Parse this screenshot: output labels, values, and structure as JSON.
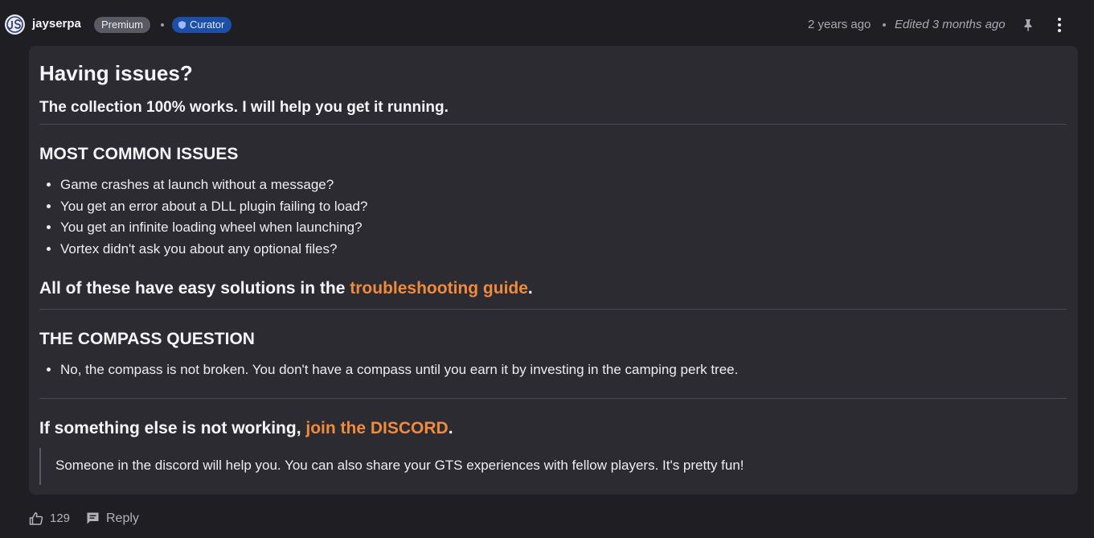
{
  "header": {
    "username": "jayserpa",
    "badge_premium": "Premium",
    "badge_curator": "Curator",
    "posted": "2 years ago",
    "edited": "Edited 3 months ago",
    "icons": {
      "avatar": "avatar-icon",
      "curator": "shield-icon",
      "pin": "pin-icon",
      "more": "more-vertical-icon"
    }
  },
  "post": {
    "title": "Having issues?",
    "subtitle": "The collection 100% works. I will help you get it running.",
    "section1_title": "MOST COMMON ISSUES",
    "section1_items": [
      "Game crashes at launch without a message?",
      "You get an error about a DLL plugin failing to load?",
      "You get an infinite loading wheel when launching?",
      "Vortex didn't ask you about any optional files?"
    ],
    "solutions_prefix": "All of these have easy solutions in the ",
    "solutions_link": "troubleshooting guide",
    "solutions_suffix": ".",
    "section2_title": "THE COMPASS QUESTION",
    "section2_items": [
      "No, the compass is not broken. You don't have a compass until you earn it by investing in the camping perk tree."
    ],
    "discord_prefix": "If something else is not working, ",
    "discord_link": "join the DISCORD",
    "discord_suffix": ".",
    "quote": "Someone in the discord will help you. You can also share your GTS experiences with fellow players. It's pretty fun!"
  },
  "footer": {
    "like_count": "129",
    "reply_label": "Reply"
  },
  "colors": {
    "background": "#1f1f23",
    "card": "#2b2b31",
    "link": "#f08a3c",
    "curator_badge": "#1b4fa8",
    "premium_badge": "#5a5a63"
  }
}
